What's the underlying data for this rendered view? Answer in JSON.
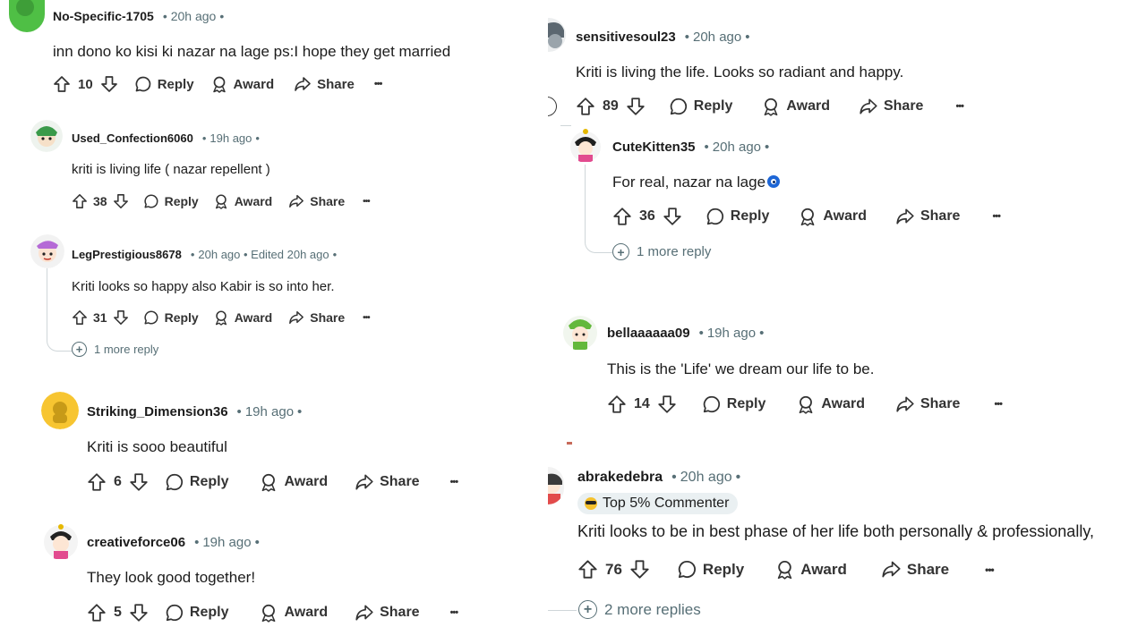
{
  "left": {
    "comments": [
      {
        "user": "No-Specific-1705",
        "meta": "20h ago",
        "text": "inn dono ko kisi ki nazar na lage ps:I hope they get married",
        "votes": "10"
      },
      {
        "user": "Used_Confection6060",
        "meta": "19h ago",
        "text": "kriti is living life ( nazar repellent )",
        "votes": "38"
      },
      {
        "user": "LegPrestigious8678",
        "meta": "20h ago • Edited 20h ago",
        "text": "Kriti looks so happy also Kabir is so into her.",
        "votes": "31",
        "more_replies": "1 more reply"
      },
      {
        "user": "Striking_Dimension36",
        "meta": "19h ago",
        "text": "Kriti is sooo beautiful",
        "votes": "6"
      },
      {
        "user": "creativeforce06",
        "meta": "19h ago",
        "text": "They look good together!",
        "votes": "5"
      }
    ]
  },
  "right": {
    "comments": [
      {
        "user": "sensitivesoul23",
        "meta": "20h ago",
        "text": "Kriti is living the life. Looks so radiant and happy.",
        "votes": "89"
      },
      {
        "user": "CuteKitten35",
        "meta": "20h ago",
        "text": "For real, nazar na lage",
        "votes": "36",
        "more_replies": "1 more reply"
      },
      {
        "user": "bellaaaaaa09",
        "meta": "19h ago",
        "text": "This is the 'Life' we dream our life to be.",
        "votes": "14"
      },
      {
        "user": "abrakedebra",
        "meta": "20h ago",
        "badge": "Top 5% Commenter",
        "text": "Kriti looks to be in best phase of her life both personally & professionally,",
        "votes": "76",
        "more_replies": "2 more replies"
      }
    ]
  },
  "actions": {
    "reply": "Reply",
    "award": "Award",
    "share": "Share",
    "more": "•••"
  },
  "separator": "•",
  "colors": {
    "text": "#1c1c1c",
    "meta": "#576f76",
    "badge_bg": "#eaf0f2",
    "thread_line": "#cfd6d9",
    "evil_eye": "#1d66d6"
  }
}
